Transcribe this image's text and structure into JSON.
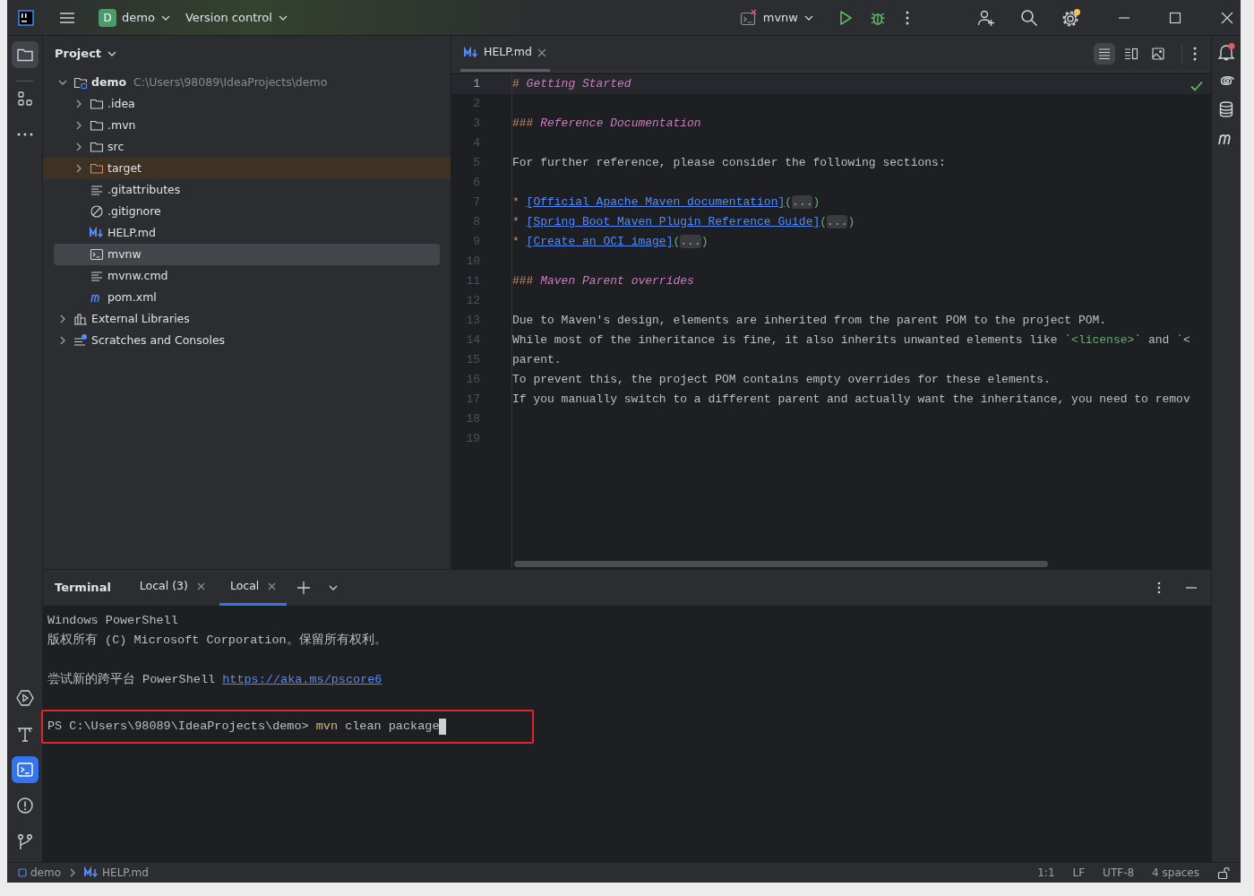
{
  "title_bar": {
    "project_letter": "D",
    "project_name": "demo",
    "vcs": "Version control",
    "run_config": "mvnw"
  },
  "project_panel": {
    "title": "Project",
    "tree": [
      {
        "name": "demo",
        "path": "C:\\Users\\98089\\IdeaProjects\\demo",
        "kind": "root",
        "expanded": true,
        "selected": false,
        "children": [
          {
            "name": ".idea",
            "kind": "folder",
            "expanded": false,
            "selected": false
          },
          {
            "name": ".mvn",
            "kind": "folder",
            "expanded": false,
            "selected": false
          },
          {
            "name": "src",
            "kind": "folder",
            "expanded": false,
            "selected": false
          },
          {
            "name": "target",
            "kind": "excluded",
            "expanded": false,
            "selected": false
          },
          {
            "name": ".gitattributes",
            "kind": "text",
            "selected": false
          },
          {
            "name": ".gitignore",
            "kind": "ignore",
            "selected": false
          },
          {
            "name": "HELP.md",
            "kind": "markdown",
            "selected": false
          },
          {
            "name": "mvnw",
            "kind": "script",
            "selected": true
          },
          {
            "name": "mvnw.cmd",
            "kind": "text",
            "selected": false
          },
          {
            "name": "pom.xml",
            "kind": "maven",
            "selected": false
          }
        ]
      },
      {
        "name": "External Libraries",
        "kind": "libraries",
        "expanded": false,
        "selected": false
      },
      {
        "name": "Scratches and Consoles",
        "kind": "scratches",
        "expanded": false,
        "selected": false
      }
    ]
  },
  "editor": {
    "tabs": [
      {
        "label": "HELP.md",
        "selected": true
      }
    ],
    "lines": [
      {
        "number": "1",
        "current": true,
        "segments": [
          {
            "text": "# ",
            "kind": "marker"
          },
          {
            "text": "Getting Started",
            "kind": "heading"
          }
        ]
      },
      {
        "number": "2",
        "current": false
      },
      {
        "number": "3",
        "current": false,
        "segments": [
          {
            "text": "### ",
            "kind": "marker"
          },
          {
            "text": "Reference Documentation",
            "kind": "heading"
          }
        ]
      },
      {
        "number": "4",
        "current": false
      },
      {
        "number": "5",
        "current": false,
        "segments": [
          {
            "text": "For further reference, please consider the following sections:",
            "kind": "plain"
          }
        ]
      },
      {
        "number": "6",
        "current": false
      },
      {
        "number": "7",
        "current": false,
        "segments": [
          {
            "text": "* ",
            "kind": "marker"
          },
          {
            "text": "[Official Apache Maven documentation]",
            "kind": "link"
          },
          {
            "text": "(",
            "kind": "paren"
          },
          {
            "text": "...",
            "kind": "fold"
          },
          {
            "text": ")",
            "kind": "paren"
          }
        ]
      },
      {
        "number": "8",
        "current": false,
        "segments": [
          {
            "text": "* ",
            "kind": "marker"
          },
          {
            "text": "[Spring Boot Maven Plugin Reference Guide]",
            "kind": "link"
          },
          {
            "text": "(",
            "kind": "paren"
          },
          {
            "text": "...",
            "kind": "fold"
          },
          {
            "text": ")",
            "kind": "paren"
          }
        ]
      },
      {
        "number": "9",
        "current": false,
        "segments": [
          {
            "text": "* ",
            "kind": "marker"
          },
          {
            "text": "[Create an OCI image]",
            "kind": "link"
          },
          {
            "text": "(",
            "kind": "paren"
          },
          {
            "text": "...",
            "kind": "fold"
          },
          {
            "text": ")",
            "kind": "paren"
          }
        ]
      },
      {
        "number": "10",
        "current": false
      },
      {
        "number": "11",
        "current": false,
        "segments": [
          {
            "text": "### ",
            "kind": "marker"
          },
          {
            "text": "Maven Parent overrides",
            "kind": "heading"
          }
        ]
      },
      {
        "number": "12",
        "current": false
      },
      {
        "number": "13",
        "current": false,
        "segments": [
          {
            "text": "Due to Maven's design, elements are inherited from the parent POM to the project POM.",
            "kind": "plain"
          }
        ]
      },
      {
        "number": "14",
        "current": false,
        "segments": [
          {
            "text": "While most of the inheritance is fine, it also inherits unwanted elements like `",
            "kind": "plain"
          },
          {
            "text": "<license>",
            "kind": "code"
          },
          {
            "text": "` and `<",
            "kind": "plain"
          }
        ]
      },
      {
        "number": "15",
        "current": false,
        "segments": [
          {
            "text": "parent.",
            "kind": "plain"
          }
        ]
      },
      {
        "number": "16",
        "current": false,
        "segments": [
          {
            "text": "To prevent this, the project POM contains empty overrides for these elements.",
            "kind": "plain"
          }
        ]
      },
      {
        "number": "17",
        "current": false,
        "segments": [
          {
            "text": "If you manually switch to a different parent and actually want the inheritance, you need to remov",
            "kind": "plain"
          }
        ]
      },
      {
        "number": "18",
        "current": false
      },
      {
        "number": "19",
        "current": false
      }
    ]
  },
  "terminal": {
    "title": "Terminal",
    "tabs": [
      {
        "label": "Local (3)",
        "selected": false
      },
      {
        "label": "Local",
        "selected": true
      }
    ],
    "lines": [
      {
        "kind": "text",
        "segments": [
          {
            "text": "Windows PowerShell",
            "kind": "plain"
          }
        ]
      },
      {
        "kind": "text",
        "segments": [
          {
            "text": "版权所有 (C) Microsoft Corporation。保留所有权利。",
            "kind": "plain"
          }
        ]
      },
      {
        "kind": "blank"
      },
      {
        "kind": "text",
        "segments": [
          {
            "text": "尝试新的跨平台 PowerShell ",
            "kind": "plain"
          },
          {
            "text": "https://aka.ms/pscore6",
            "kind": "link"
          }
        ]
      },
      {
        "kind": "blank"
      },
      {
        "kind": "prompt",
        "highlighted": true,
        "cursor": true,
        "segments": [
          {
            "text": "PS C:\\Users\\98089\\IdeaProjects\\demo> ",
            "kind": "plain"
          },
          {
            "text": "mvn",
            "kind": "command"
          },
          {
            "text": " clean package",
            "kind": "plain"
          }
        ]
      }
    ]
  },
  "status_bar": {
    "breadcrumbs": [
      {
        "label": "demo",
        "kind": "module"
      },
      {
        "label": "HELP.md",
        "kind": "markdown"
      }
    ],
    "items": [
      "1:1",
      "LF",
      "UTF-8",
      "4 spaces"
    ]
  }
}
